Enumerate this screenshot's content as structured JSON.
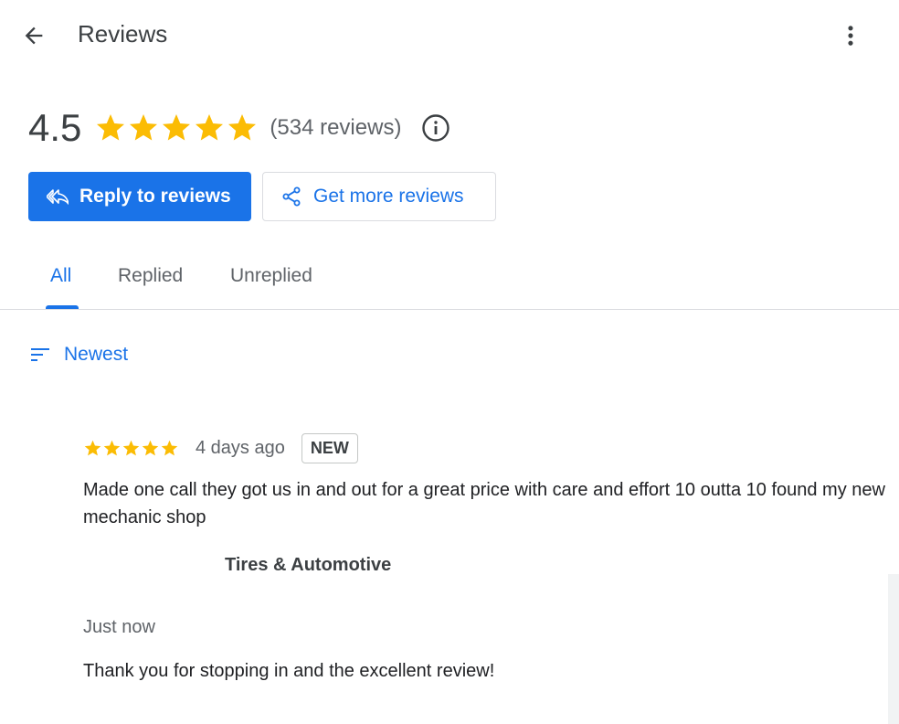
{
  "header": {
    "title": "Reviews",
    "back_icon": "arrow-back-icon",
    "more_icon": "more-vert-icon"
  },
  "summary": {
    "rating": "4.5",
    "stars_filled": 5,
    "review_count_text": "(534 reviews)",
    "info_icon": "info-icon"
  },
  "actions": {
    "reply_label": "Reply to reviews",
    "reply_icon": "reply-all-icon",
    "get_more_label": "Get more reviews",
    "share_icon": "share-icon"
  },
  "tabs": [
    {
      "label": "All",
      "active": true
    },
    {
      "label": "Replied",
      "active": false
    },
    {
      "label": "Unreplied",
      "active": false
    }
  ],
  "sort": {
    "label": "Newest",
    "icon": "sort-icon"
  },
  "review": {
    "stars": 5,
    "date": "4 days ago",
    "badge": "NEW",
    "text": "Made one call they got us in and out for a great price with care and effort 10 outta 10 found my new mechanic shop",
    "owner_name": "Tires & Automotive",
    "reply_time": "Just now",
    "reply_text": "Thank you for stopping in and the excellent review!"
  },
  "colors": {
    "accent": "#1a73e8",
    "star": "#fbbc04",
    "divider": "#dadce0",
    "text_secondary": "#5f6368"
  }
}
